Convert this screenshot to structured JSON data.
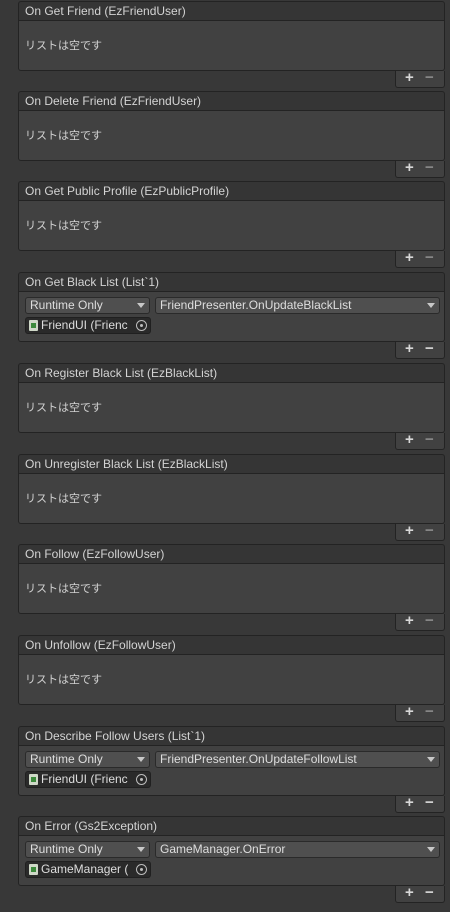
{
  "events": [
    {
      "title": "On Get Friend (EzFriendUser)",
      "empty_text": "リストは空です"
    },
    {
      "title": "On Delete Friend (EzFriendUser)",
      "empty_text": "リストは空です"
    },
    {
      "title": "On Get Public Profile (EzPublicProfile)",
      "empty_text": "リストは空です"
    },
    {
      "title": "On Get Black List (List`1)",
      "listener": {
        "call_state": "Runtime Only",
        "method": "FriendPresenter.OnUpdateBlackList",
        "target": "FriendUI (Frienc"
      }
    },
    {
      "title": "On Register Black List (EzBlackList)",
      "empty_text": "リストは空です"
    },
    {
      "title": "On Unregister Black List (EzBlackList)",
      "empty_text": "リストは空です"
    },
    {
      "title": "On Follow (EzFollowUser)",
      "empty_text": "リストは空です"
    },
    {
      "title": "On Unfollow (EzFollowUser)",
      "empty_text": "リストは空です"
    },
    {
      "title": "On Describe Follow Users (List`1)",
      "listener": {
        "call_state": "Runtime Only",
        "method": "FriendPresenter.OnUpdateFollowList",
        "target": "FriendUI (Frienc"
      }
    },
    {
      "title": "On Error (Gs2Exception)",
      "listener": {
        "call_state": "Runtime Only",
        "method": "GameManager.OnError",
        "target": "GameManager ("
      }
    }
  ],
  "footer": {
    "add_label": "+",
    "remove_label": "−"
  }
}
